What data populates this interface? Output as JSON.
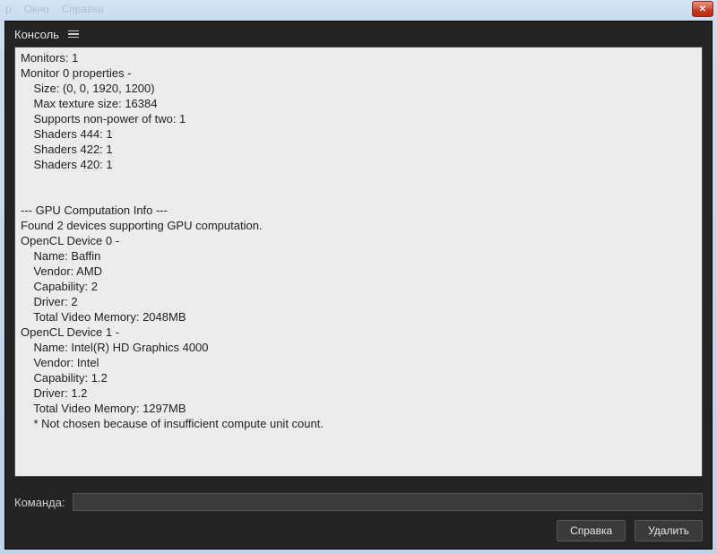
{
  "outer_menu": {
    "item1": "р",
    "item2": "Окно",
    "item3": "Справка"
  },
  "close_glyph": "✕",
  "titlebar": {
    "title": "Консоль"
  },
  "console_text": "Monitors: 1\nMonitor 0 properties -\n    Size: (0, 0, 1920, 1200)\n    Max texture size: 16384\n    Supports non-power of two: 1\n    Shaders 444: 1\n    Shaders 422: 1\n    Shaders 420: 1\n\n\n--- GPU Computation Info ---\nFound 2 devices supporting GPU computation.\nOpenCL Device 0 -\n    Name: Baffin\n    Vendor: AMD\n    Capability: 2\n    Driver: 2\n    Total Video Memory: 2048MB\nOpenCL Device 1 -\n    Name: Intel(R) HD Graphics 4000\n    Vendor: Intel\n    Capability: 1.2\n    Driver: 1.2\n    Total Video Memory: 1297MB\n    * Not chosen because of insufficient compute unit count.\n",
  "command": {
    "label": "Команда:",
    "value": "",
    "placeholder": ""
  },
  "buttons": {
    "help": "Справка",
    "clear": "Удалить"
  }
}
